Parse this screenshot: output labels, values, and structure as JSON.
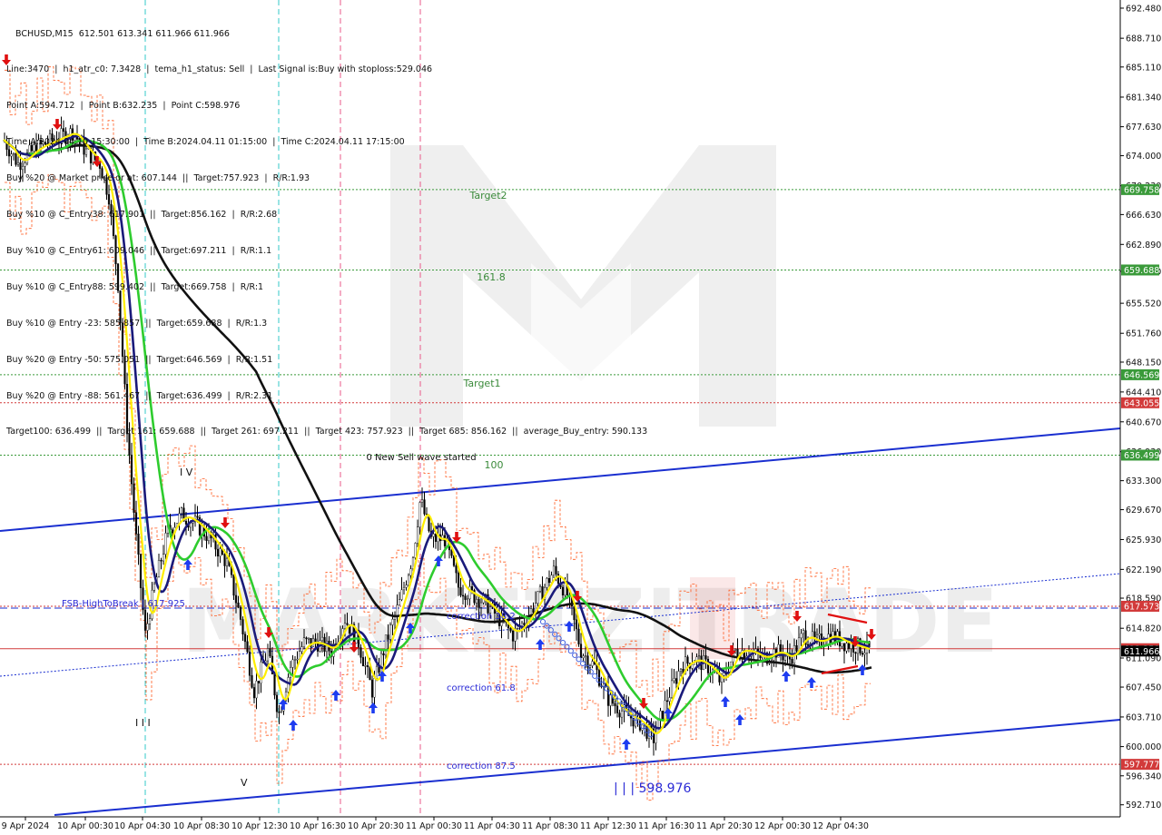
{
  "header": {
    "symbol_line": "BCHUSD,M15  612.501 613.341 611.966 611.966",
    "lines": [
      "Line:3470  |  h1_atr_c0: 7.3428  |  tema_h1_status: Sell  |  Last Signal is:Buy with stoploss:529.046",
      "Point A:594.712  |  Point B:632.235  |  Point C:598.976",
      "Time A:2024.04.10 15:30:00  |  Time B:2024.04.11 01:15:00  |  Time C:2024.04.11 17:15:00",
      "Buy %20 @ Market price or at: 607.144  ||  Target:757.923  |  R/R:1.93",
      "Buy %10 @ C_Entry38: 617.901  ||  Target:856.162  |  R/R:2.68",
      "Buy %10 @ C_Entry61: 609.046  ||  Target:697.211  |  R/R:1.1",
      "Buy %10 @ C_Entry88: 599.402  ||  Target:669.758  |  R/R:1",
      "Buy %10 @ Entry -23: 585.857  ||  Target:659.688  |  R/R:1.3",
      "Buy %20 @ Entry -50: 575.051  ||  Target:646.569  |  R/R:1.51",
      "Buy %20 @ Entry -88: 561.467  ||  Target:636.499  |  R/R:2.31",
      "Target100: 636.499  ||  Target 161: 659.688  ||  Target 261: 697.211  ||  Target 423: 757.923  ||  Target 685: 856.162  ||  average_Buy_entry: 590.133"
    ]
  },
  "y_axis": {
    "ticks": [
      "692.480",
      "688.710",
      "685.110",
      "681.340",
      "677.630",
      "674.000",
      "670.230",
      "666.630",
      "662.890",
      "659.520",
      "655.520",
      "651.760",
      "648.150",
      "644.410",
      "640.670",
      "636.930",
      "633.300",
      "629.670",
      "625.930",
      "622.190",
      "618.590",
      "614.820",
      "611.090",
      "607.450",
      "603.710",
      "600.000",
      "596.340",
      "592.710"
    ]
  },
  "x_axis": {
    "ticks": [
      "9 Apr 2024",
      "10 Apr 00:30",
      "10 Apr 04:30",
      "10 Apr 08:30",
      "10 Apr 12:30",
      "10 Apr 16:30",
      "10 Apr 20:30",
      "11 Apr 00:30",
      "11 Apr 04:30",
      "11 Apr 08:30",
      "11 Apr 12:30",
      "11 Apr 16:30",
      "11 Apr 20:30",
      "12 Apr 00:30",
      "12 Apr 04:30"
    ]
  },
  "price_tags": [
    {
      "text": "669.758",
      "color": "#3a9a3a"
    },
    {
      "text": "659.688",
      "color": "#3a9a3a"
    },
    {
      "text": "646.569",
      "color": "#3a9a3a"
    },
    {
      "text": "643.055",
      "color": "#d23a3a"
    },
    {
      "text": "636.499",
      "color": "#3a9a3a"
    },
    {
      "text": "617.573",
      "color": "#d23a3a"
    },
    {
      "text": "612.258",
      "color": "#d23a3a"
    },
    {
      "text": "611.966",
      "color": "#000000"
    },
    {
      "text": "597.777",
      "color": "#d23a3a"
    }
  ],
  "annotations": {
    "target2": "Target2",
    "fib161": "161.8",
    "target1": "Target1",
    "fib100": "100",
    "new_sell_wave": "0 New Sell wave started",
    "fsb": "FSB-HighToBreak | 617.925",
    "corr382": "correction 38.2",
    "corr618": "correction 61.8",
    "corr875": "correction 87.5",
    "point_c_label": "| | | 598.976",
    "wave_iv": "I V",
    "wave_iii": "I I I",
    "wave_v": "V",
    "watermark": "MARKETZITRADE"
  },
  "chart_data": {
    "type": "line",
    "title": "BCHUSD,M15",
    "ylim": [
      591.2,
      693.5
    ],
    "symbol": "BCHUSD",
    "timeframe": "M15",
    "ohlc_last": {
      "open": 612.501,
      "high": 613.341,
      "low": 611.966,
      "close": 611.966
    },
    "levels": [
      {
        "name": "Target2",
        "value": 669.758,
        "color": "#3a9a3a"
      },
      {
        "name": "161.8",
        "value": 659.688,
        "color": "#3a9a3a"
      },
      {
        "name": "Target1",
        "value": 646.569,
        "color": "#3a9a3a"
      },
      {
        "name": "",
        "value": 643.055,
        "color": "#d23a3a"
      },
      {
        "name": "100",
        "value": 636.499,
        "color": "#3a9a3a"
      },
      {
        "name": "FSB-HighToBreak",
        "value": 617.925,
        "color": "#2b2bd6"
      },
      {
        "name": "",
        "value": 617.573,
        "color": "#d23a3a"
      },
      {
        "name": "",
        "value": 612.258,
        "color": "#d23a3a"
      },
      {
        "name": "",
        "value": 597.777,
        "color": "#d23a3a"
      }
    ],
    "key_points": {
      "A": 594.712,
      "B": 632.235,
      "C": 598.976
    }
  }
}
